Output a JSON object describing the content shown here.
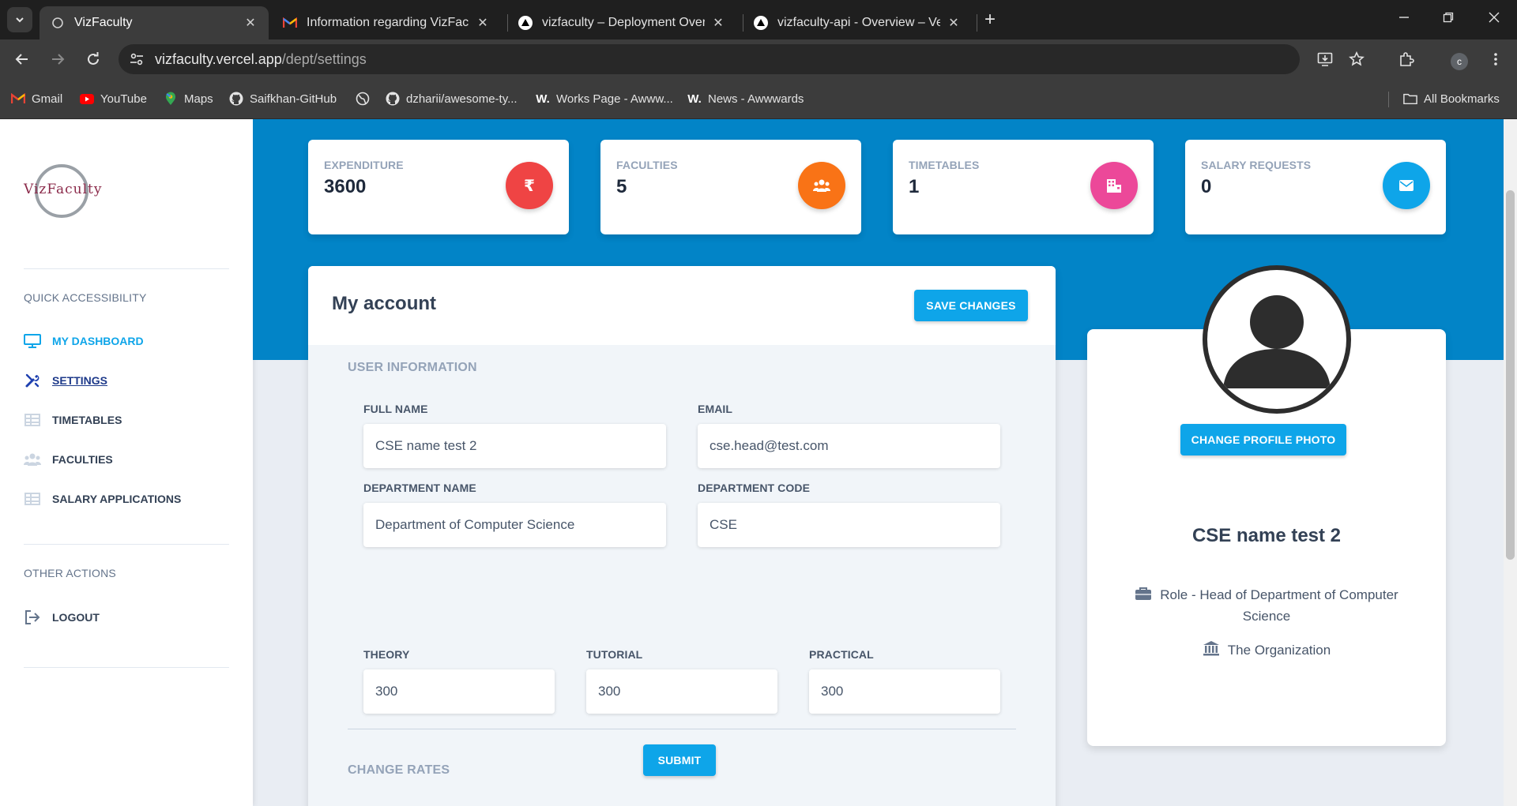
{
  "browser": {
    "tabs": [
      {
        "title": "VizFaculty",
        "active": true
      },
      {
        "title": "Information regarding VizFaculty",
        "active": false
      },
      {
        "title": "vizfaculty – Deployment Overview",
        "active": false
      },
      {
        "title": "vizfaculty-api - Overview – Vercel",
        "active": false
      }
    ],
    "url_host": "vizfaculty.vercel.app",
    "url_path": "/dept/settings",
    "profile_initial": "c",
    "bookmarks": [
      {
        "label": "Gmail",
        "icon": "gmail-icon"
      },
      {
        "label": "YouTube",
        "icon": "youtube-icon"
      },
      {
        "label": "Maps",
        "icon": "maps-icon"
      },
      {
        "label": "Saifkhan-GitHub",
        "icon": "github-icon"
      },
      {
        "label": "",
        "icon": "globe-icon"
      },
      {
        "label": "dzharii/awesome-ty...",
        "icon": "github-icon"
      },
      {
        "label": "Works Page - Awww...",
        "icon": "awwwards-icon"
      },
      {
        "label": "News - Awwwards",
        "icon": "awwwards-icon"
      }
    ],
    "all_bookmarks": "All Bookmarks"
  },
  "sidebar": {
    "logo_text": "VizFaculty",
    "quick_heading": "QUICK ACCESSIBILITY",
    "items": [
      {
        "label": "MY DASHBOARD",
        "icon": "monitor-icon"
      },
      {
        "label": "SETTINGS",
        "icon": "tools-icon"
      },
      {
        "label": "TIMETABLES",
        "icon": "table-icon"
      },
      {
        "label": "FACULTIES",
        "icon": "users-icon"
      },
      {
        "label": "SALARY APPLICATIONS",
        "icon": "table-icon"
      }
    ],
    "other_heading": "OTHER ACTIONS",
    "logout": "LOGOUT"
  },
  "stats": [
    {
      "label": "EXPENDITURE",
      "value": "3600",
      "icon": "rupee-icon",
      "color": "#ef4444"
    },
    {
      "label": "FACULTIES",
      "value": "5",
      "icon": "users-icon",
      "color": "#f97316"
    },
    {
      "label": "TIMETABLES",
      "value": "1",
      "icon": "building-icon",
      "color": "#ec4899"
    },
    {
      "label": "SALARY REQUESTS",
      "value": "0",
      "icon": "envelope-icon",
      "color": "#0ea5e9"
    }
  ],
  "account": {
    "title": "My account",
    "save_label": "SAVE CHANGES",
    "user_info_heading": "USER INFORMATION",
    "full_name_label": "FULL NAME",
    "full_name_value": "CSE name test 2",
    "email_label": "EMAIL",
    "email_value": "cse.head@test.com",
    "dept_name_label": "DEPARTMENT NAME",
    "dept_name_value": "Department of Computer Science",
    "dept_code_label": "DEPARTMENT CODE",
    "dept_code_value": "CSE",
    "rates_heading": "CHANGE RATES",
    "theory_label": "THEORY",
    "theory_value": "300",
    "tutorial_label": "TUTORIAL",
    "tutorial_value": "300",
    "practical_label": "PRACTICAL",
    "practical_value": "300",
    "submit_label": "SUBMIT"
  },
  "profile": {
    "change_photo_label": "CHANGE PROFILE PHOTO",
    "name": "CSE name test 2",
    "role": "Role - Head of Department of Computer Science",
    "organization": "The Organization"
  },
  "colors": {
    "accent": "#0ea5e9",
    "hero": "#0284c7"
  }
}
